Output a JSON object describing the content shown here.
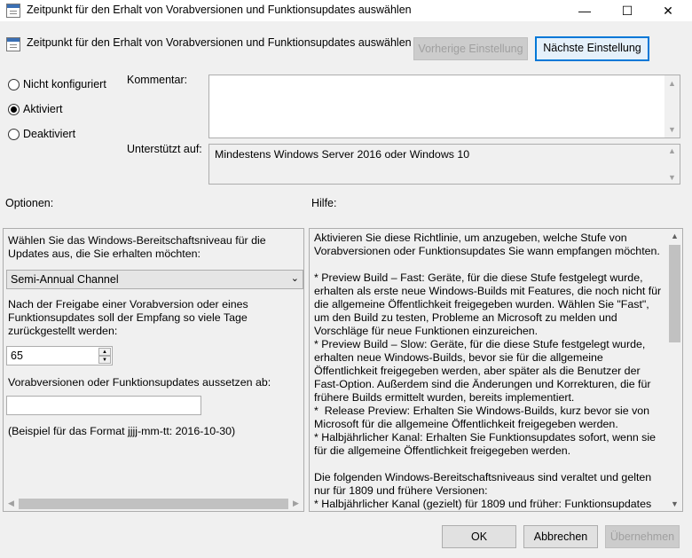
{
  "window": {
    "title": "Zeitpunkt für den Erhalt von Vorabversionen und Funktionsupdates auswählen",
    "minimize_glyph": "—",
    "maximize_glyph": "☐",
    "close_glyph": "✕"
  },
  "header": {
    "policy_title": "Zeitpunkt für den Erhalt von Vorabversionen und Funktionsupdates auswählen",
    "prev_label": "Vorherige Einstellung",
    "next_label": "Nächste Einstellung"
  },
  "state": {
    "options": [
      "Nicht konfiguriert",
      "Aktiviert",
      "Deaktiviert"
    ],
    "selected": "Aktiviert"
  },
  "comment": {
    "label": "Kommentar:",
    "value": ""
  },
  "supported": {
    "label": "Unterstützt auf:",
    "value": "Mindestens Windows Server 2016 oder Windows 10"
  },
  "sections": {
    "options_label": "Optionen:",
    "help_label": "Hilfe:"
  },
  "options_panel": {
    "readiness_label": "Wählen Sie das Windows-Bereitschaftsniveau für die Updates aus, die Sie erhalten möchten:",
    "channel_value": "Semi-Annual Channel",
    "defer_label": "Nach der Freigabe einer Vorabversion oder eines Funktionsupdates soll der Empfang so viele Tage zurückgestellt werden:",
    "defer_days": "65",
    "pause_label": "Vorabversionen oder Funktionsupdates aussetzen ab:",
    "pause_value": "",
    "example_text": "(Beispiel für das Format jjjj-mm-tt: 2016-10-30)"
  },
  "help_panel": {
    "text": "Aktivieren Sie diese Richtlinie, um anzugeben, welche Stufe von Vorabversionen oder Funktionsupdates Sie wann empfangen möchten.\n\n* Preview Build – Fast: Geräte, für die diese Stufe festgelegt wurde, erhalten als erste neue Windows-Builds mit Features, die noch nicht für die allgemeine Öffentlichkeit freigegeben wurden. Wählen Sie \"Fast\", um den Build zu testen, Probleme an Microsoft zu melden und Vorschläge für neue Funktionen einzureichen.\n* Preview Build – Slow: Geräte, für die diese Stufe festgelegt wurde, erhalten neue Windows-Builds, bevor sie für die allgemeine Öffentlichkeit freigegeben werden, aber später als die Benutzer der Fast-Option. Außerdem sind die Änderungen und Korrekturen, die für frühere Builds ermittelt wurden, bereits implementiert.\n*  Release Preview: Erhalten Sie Windows-Builds, kurz bevor sie von Microsoft für die allgemeine Öffentlichkeit freigegeben werden.\n* Halbjährlicher Kanal: Erhalten Sie Funktionsupdates sofort, wenn sie für die allgemeine Öffentlichkeit freigegeben werden.\n\nDie folgenden Windows-Bereitschaftsniveaus sind veraltet und gelten nur für 1809 und frühere Versionen:\n* Halbjährlicher Kanal (gezielt) für 1809 und früher: Funktionsupdates"
  },
  "footer": {
    "ok_label": "OK",
    "cancel_label": "Abbrechen",
    "apply_label": "Übernehmen"
  }
}
